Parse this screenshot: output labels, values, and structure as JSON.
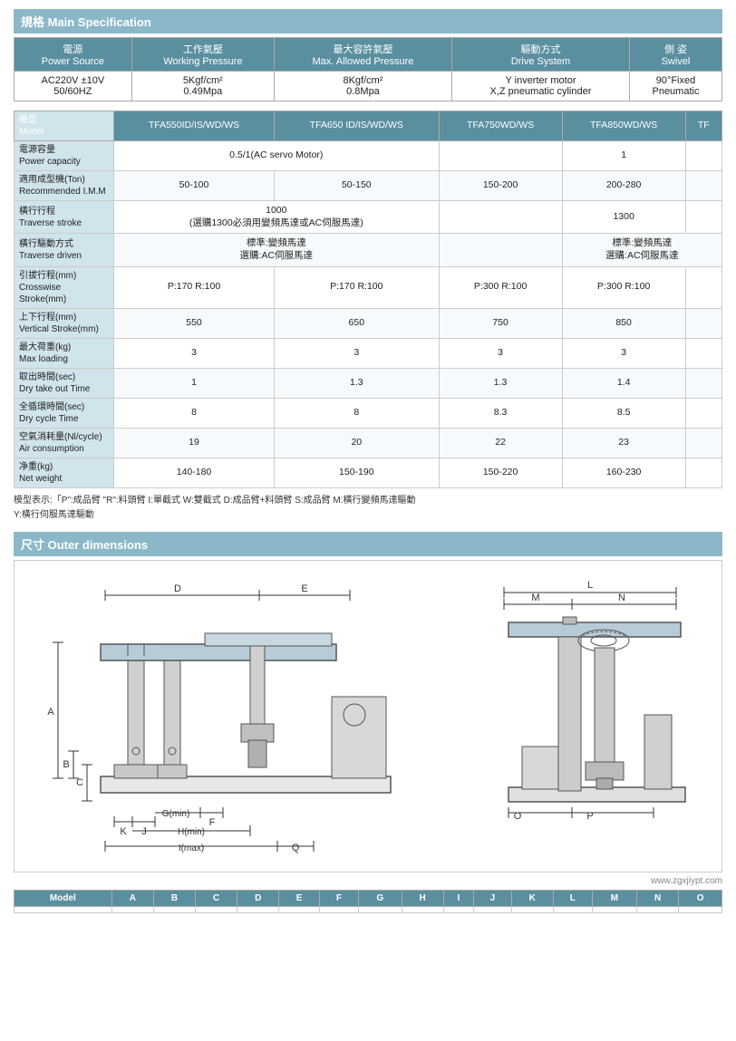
{
  "sections": {
    "main_spec": {
      "title": "規格 Main Specification",
      "power_table": {
        "headers": [
          {
            "zh": "電源",
            "en": "Power Source"
          },
          {
            "zh": "工作氣壓",
            "en": "Working Pressure"
          },
          {
            "zh": "最大容許氣壓",
            "en": "Max. Allowed Pressure"
          },
          {
            "zh": "驅動方式",
            "en": "Drive System"
          },
          {
            "zh": "側 姿",
            "en": "Swivel"
          }
        ],
        "rows": [
          [
            "AC220V ±10V\n50/60HZ",
            "5Kgf/cm²\n0.49Mpa",
            "8Kgf/cm²\n0.8Mpa",
            "Y inverter motor\nX,Z pneumatic cylinder",
            "90°Fixed\nPneumatic"
          ]
        ]
      },
      "model_table": {
        "col_headers": [
          "TFA550ID/IS/WD/WS",
          "TFA650 ID/IS/WD/WS",
          "TFA750WD/WS",
          "TFA850WD/WS",
          "TF"
        ],
        "rows": [
          {
            "zh": "電源容量",
            "en": "Power capacity",
            "values": [
              "0.5/1(AC servo Motor)",
              "",
              "",
              "1",
              ""
            ]
          },
          {
            "zh": "適用成型機(Ton)",
            "en": "Recommended I.M.M",
            "values": [
              "50-100",
              "50-150",
              "150-200",
              "200-280",
              ""
            ]
          },
          {
            "zh": "橫行行程",
            "en": "Traverse stroke",
            "values": [
              "1000\n(選購1300必須用變頻馬達或AC伺服馬達)",
              "",
              "",
              "1300",
              ""
            ]
          },
          {
            "zh": "橫行驅動方式",
            "en": "Traverse driven",
            "values": [
              "標準:變頻馬達\n選購:AC伺服馬達",
              "",
              "標準:變頻馬達\n選購:AC伺服馬達",
              "",
              ""
            ]
          },
          {
            "zh": "引拔行程(mm)",
            "en": "Crosswise Stroke(mm)",
            "values": [
              "P:170  R:100",
              "P:170  R:100",
              "P:300  R:100",
              "P:300  R:100",
              ""
            ]
          },
          {
            "zh": "上下行程(mm)",
            "en": "Vertical Stroke(mm)",
            "values": [
              "550",
              "650",
              "750",
              "850",
              ""
            ]
          },
          {
            "zh": "最大荷重(kg)",
            "en": "Max loading",
            "values": [
              "3",
              "3",
              "3",
              "3",
              ""
            ]
          },
          {
            "zh": "取出時間(sec)",
            "en": "Dry take out Time",
            "values": [
              "1",
              "1.3",
              "1.3",
              "1.4",
              ""
            ]
          },
          {
            "zh": "全循環時間(sec)",
            "en": "Dry cycle Time",
            "values": [
              "8",
              "8",
              "8.3",
              "8.5",
              ""
            ]
          },
          {
            "zh": "空氣消耗量(Nl/cycle)",
            "en": "Air consumption",
            "values": [
              "19",
              "20",
              "22",
              "23",
              ""
            ]
          },
          {
            "zh": "净重(kg)",
            "en": "Net weight",
            "values": [
              "140-180",
              "150-190",
              "150-220",
              "160-230",
              ""
            ]
          }
        ]
      },
      "notes": [
        "模型表示:「P\":成品臂  \"R\":料頭臂 I:單截式  W:雙截式  D:成品臂+料頭臂  S:成品臂  M:橫行變頻馬達驅動",
        "Y:橫行伺服馬達驅動"
      ]
    },
    "outer_dimensions": {
      "title": "尺寸 Outer dimensions"
    },
    "dim_table": {
      "headers": [
        "Model",
        "A",
        "B",
        "C",
        "D",
        "E",
        "F",
        "G",
        "H",
        "I",
        "J",
        "K",
        "L",
        "M",
        "N",
        "O"
      ],
      "rows": []
    }
  },
  "watermark": "www.zgxjiypt.com"
}
